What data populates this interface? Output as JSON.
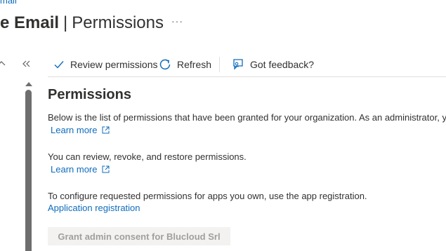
{
  "breadcrumb": {
    "text": "mail"
  },
  "header": {
    "title_strong": "e Email",
    "separator": "|",
    "title_sub": "Permissions",
    "more_label": "···"
  },
  "toolbar": {
    "review_label": "Review permissions",
    "refresh_label": "Refresh",
    "feedback_label": "Got feedback?"
  },
  "main": {
    "heading": "Permissions",
    "intro_text": "Below is the list of permissions that have been granted for your organization. As an administrator, y",
    "learn_more_1": "Learn more",
    "review_text": "You can review, revoke, and restore permissions.",
    "learn_more_2": "Learn more",
    "configure_text": "To configure requested permissions for apps you own, use the app registration.",
    "app_registration_link": "Application registration",
    "grant_button_label": "Grant admin consent for Blucloud Srl"
  },
  "icons": {
    "review": "checkmark-icon",
    "refresh": "refresh-icon",
    "feedback": "feedback-icon",
    "external": "external-link-icon",
    "collapse": "double-chevron-left-icon"
  },
  "colors": {
    "link": "#0f6cbd",
    "text": "#323130",
    "disabled_text": "#a19f9d",
    "disabled_bg": "#f3f2f1"
  }
}
